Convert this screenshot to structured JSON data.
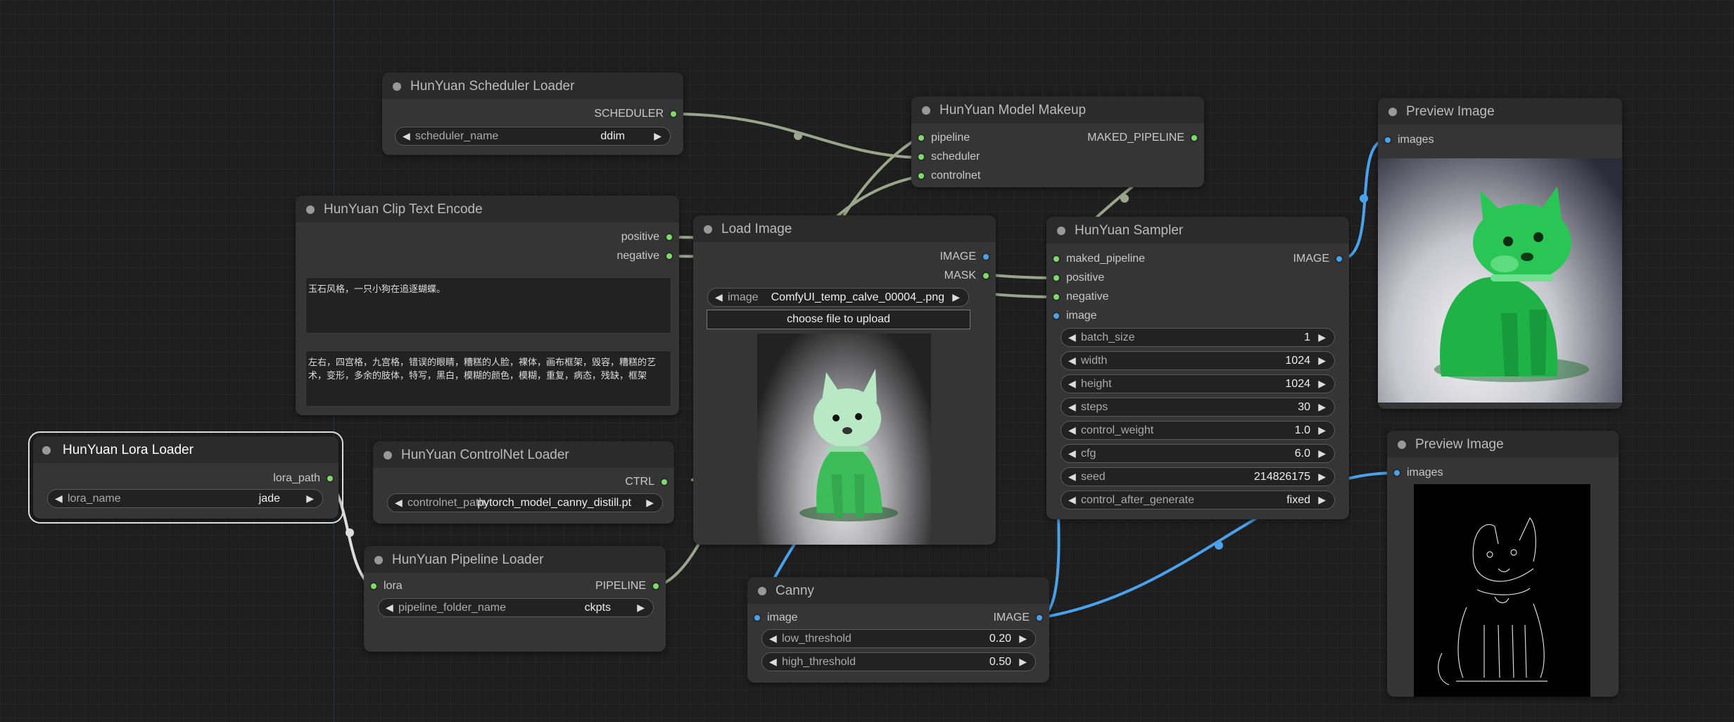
{
  "nodes": {
    "scheduler_loader": {
      "title": "HunYuan Scheduler Loader",
      "output": "SCHEDULER",
      "widget": {
        "label": "scheduler_name",
        "value": "ddim"
      }
    },
    "model_makeup": {
      "title": "HunYuan Model Makeup",
      "inputs": [
        "pipeline",
        "scheduler",
        "controlnet"
      ],
      "output": "MAKED_PIPELINE"
    },
    "clip_text_encode": {
      "title": "HunYuan Clip Text Encode",
      "outputs": [
        "positive",
        "negative"
      ],
      "positive_text": "玉石风格，一只小狗在追逐蝴蝶。",
      "negative_text": "左右，四宫格，九宫格，错误的眼睛，糟糕的人脸，裸体，画布框架，毁容，糟糕的艺术，变形，多余的肢体，特写，黑白，模糊的颜色，模糊，重复，病态，残缺，框架"
    },
    "load_image": {
      "title": "Load Image",
      "outputs": [
        "IMAGE",
        "MASK"
      ],
      "widget": {
        "label": "image",
        "value": "ComfyUI_temp_calve_00004_.png"
      },
      "upload_label": "choose file to upload"
    },
    "sampler": {
      "title": "HunYuan Sampler",
      "inputs": [
        "maked_pipeline",
        "positive",
        "negative",
        "image"
      ],
      "output": "IMAGE",
      "widgets": [
        {
          "label": "batch_size",
          "value": "1"
        },
        {
          "label": "width",
          "value": "1024"
        },
        {
          "label": "height",
          "value": "1024"
        },
        {
          "label": "steps",
          "value": "30"
        },
        {
          "label": "control_weight",
          "value": "1.0"
        },
        {
          "label": "cfg",
          "value": "6.0"
        },
        {
          "label": "seed",
          "value": "214826175"
        },
        {
          "label": "control_after_generate",
          "value": "fixed"
        }
      ]
    },
    "preview_1": {
      "title": "Preview Image",
      "input": "images"
    },
    "preview_2": {
      "title": "Preview Image",
      "input": "images"
    },
    "lora_loader": {
      "title": "HunYuan Lora Loader",
      "output": "lora_path",
      "widget": {
        "label": "lora_name",
        "value": "jade"
      }
    },
    "controlnet_loader": {
      "title": "HunYuan ControlNet Loader",
      "output": "CTRL",
      "widget": {
        "label": "controlnet_path",
        "value": "pytorch_model_canny_distill.pt"
      }
    },
    "pipeline_loader": {
      "title": "HunYuan Pipeline Loader",
      "input": "lora",
      "output": "PIPELINE",
      "widget": {
        "label": "pipeline_folder_name",
        "value": "ckpts"
      }
    },
    "canny": {
      "title": "Canny",
      "input": "image",
      "output": "IMAGE",
      "widgets": [
        {
          "label": "low_threshold",
          "value": "0.20"
        },
        {
          "label": "high_threshold",
          "value": "0.50"
        }
      ]
    }
  },
  "colors": {
    "background": "#1e1e1e",
    "node_body": "#353535",
    "node_title": "#2b2b2b",
    "pin_green": "#7ddc68",
    "pin_blue": "#4aa2ec",
    "wire_gray": "#9aa58c",
    "wire_blue": "#4aa2ec"
  }
}
